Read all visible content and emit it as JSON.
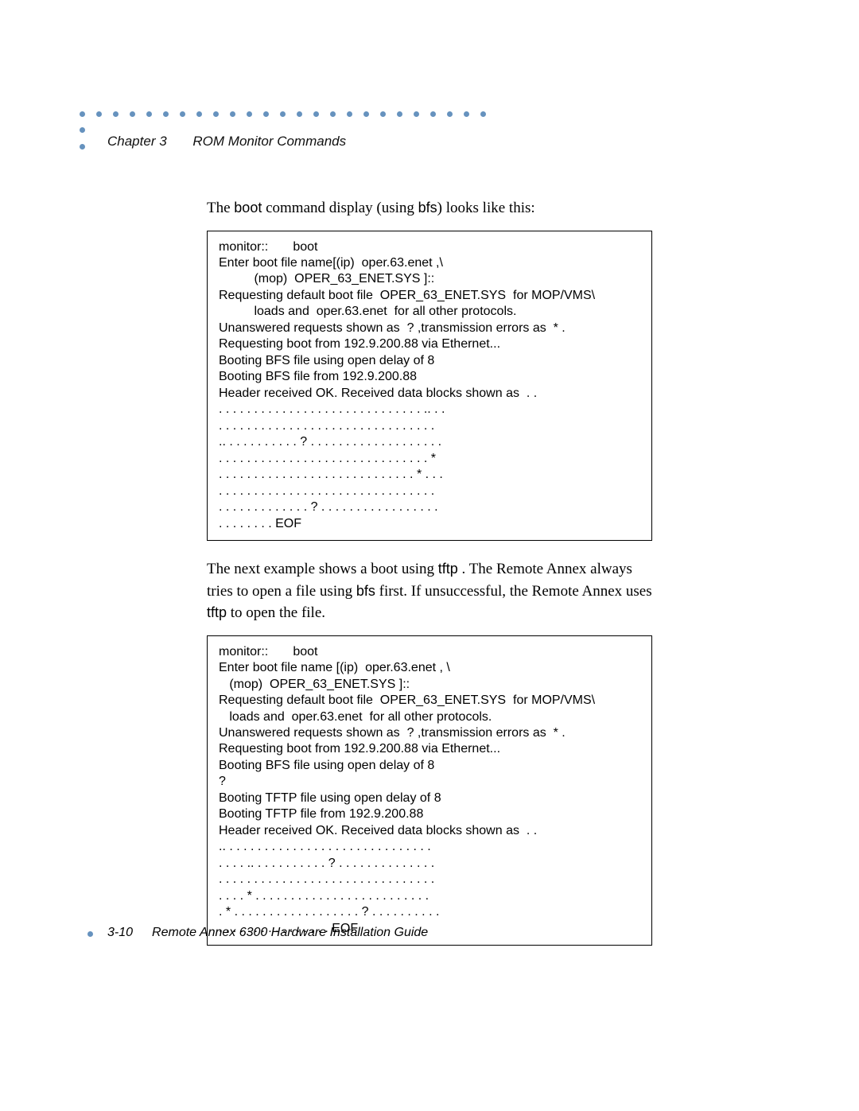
{
  "header": {
    "chapter": "Chapter 3",
    "section": "ROM Monitor Commands"
  },
  "intro1": {
    "pre": "The ",
    "cmd1": "boot",
    "mid": " command display (using ",
    "cmd2": "bfs",
    "post": ") looks like this:"
  },
  "code1": "monitor::       boot\nEnter boot file name[(ip)  oper.63.enet ,\\\n          (mop)  OPER_63_ENET.SYS ]::\nRequesting default boot file  OPER_63_ENET.SYS  for MOP/VMS\\\n          loads and  oper.63.enet  for all other protocols.\nUnanswered requests shown as  ? ,transmission errors as  * .\nRequesting boot from 192.9.200.88 via Ethernet...\nBooting BFS file using open delay of 8\nBooting BFS file from 192.9.200.88\nHeader received OK. Received data blocks shown as  . .\n. . . . . . . . . . . . . . . . . . . . . . . . . . . . . .. . .\n. . . . . . . . . . . . . . . . . . . . . . . . . . . . . . .\n.. . . . . . . . . . . ? . . . . . . . . . . . . . . . . . . .\n. . . . . . . . . . . . . . . . . . . . . . . . . . . . . . *\n. . . . . . . . . . . . . . . . . . . . . . . . . . . . * . . .\n. . . . . . . . . . . . . . . . . . . . . . . . . . . . . . .\n. . . . . . . . . . . . . ? . . . . . . . . . . . . . . . . .\n. . . . . . . . EOF",
  "intro2": {
    "pre": "The next example shows a boot using ",
    "cmd1": "tftp",
    "mid1": " . The Remote Annex always tries to open a file using ",
    "cmd2": "bfs",
    "mid2": " first. If unsuccessful, the Remote Annex uses ",
    "cmd3": "tftp",
    "post": "  to open the file."
  },
  "code2": "monitor::       boot\nEnter boot file name [(ip)  oper.63.enet , \\\n   (mop)  OPER_63_ENET.SYS ]::\nRequesting default boot file  OPER_63_ENET.SYS  for MOP/VMS\\\n   loads and  oper.63.enet  for all other protocols.\nUnanswered requests shown as  ? ,transmission errors as  * .\nRequesting boot from 192.9.200.88 via Ethernet...\nBooting BFS file using open delay of 8\n?\nBooting TFTP file using open delay of 8\nBooting TFTP file from 192.9.200.88\nHeader received OK. Received data blocks shown as  . .\n.. . . . . . . . . . . . . . . . . . . . . . . . . . . . . .\n. . . . .. . . . . . . . . . . ? . . . . . . . . . . . . . .\n. . . . . . . . . . . . . . . . . . . . . . . . . . . . . . .\n. . . . * . . . . . . . . . . . . . . . . . . . . . . . . .\n. * . . . . . . . . . . . . . . . . . . ? . . . . . . . . . .\n. . . . . . . . . . . . . . . . EOF",
  "footer": {
    "page": "3-10",
    "title": "Remote Annex 6300 Hardware Installation Guide"
  },
  "decor": {
    "dotsTop": 25,
    "dotsSide": 2
  }
}
